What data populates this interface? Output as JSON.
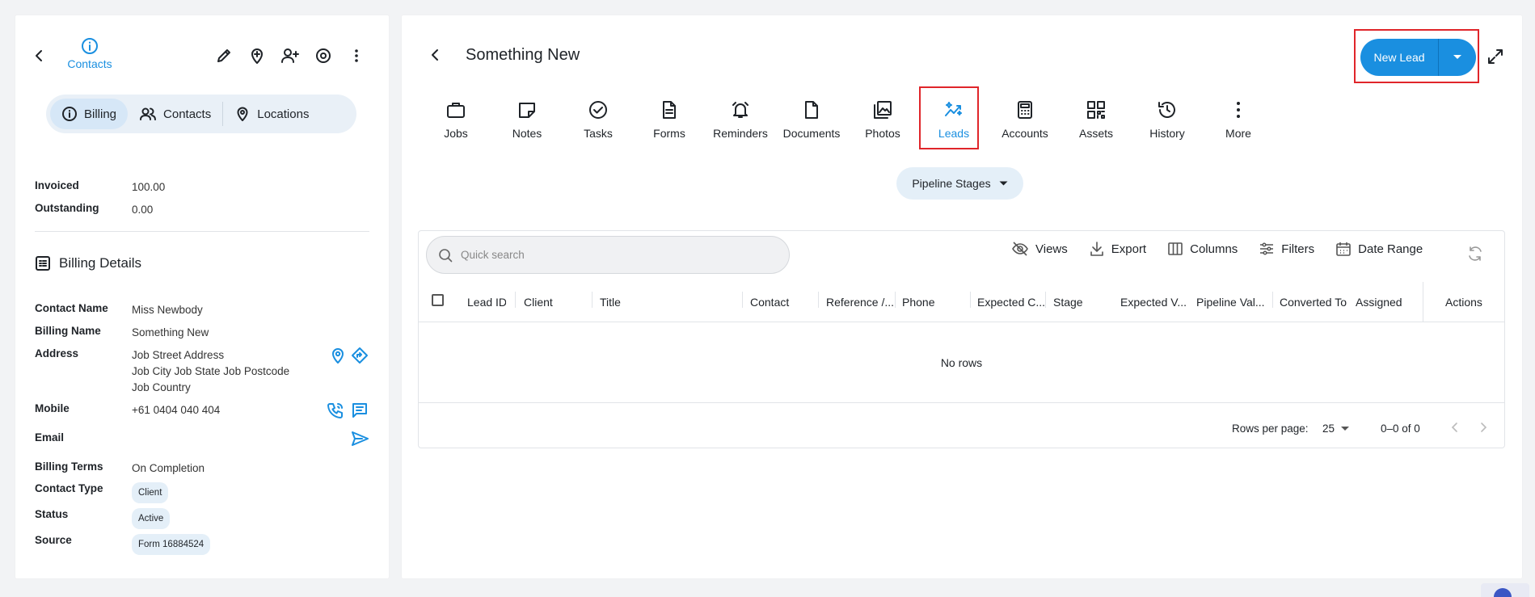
{
  "left": {
    "contacts_label": "Contacts",
    "segments": [
      {
        "label": "Billing",
        "icon": "info-icon"
      },
      {
        "label": "Contacts",
        "icon": "people-icon"
      },
      {
        "label": "Locations",
        "icon": "location-pin-icon"
      }
    ],
    "summary": {
      "invoiced_label": "Invoiced",
      "invoiced_value": "100.00",
      "outstanding_label": "Outstanding",
      "outstanding_value": "0.00"
    },
    "billing_details": {
      "title": "Billing Details",
      "contact_name_label": "Contact Name",
      "contact_name": "Miss Newbody",
      "billing_name_label": "Billing Name",
      "billing_name": "Something New",
      "address_label": "Address",
      "address_line1": "Job Street Address",
      "address_line2": "Job City Job State Job Postcode",
      "address_line3": "Job Country",
      "mobile_label": "Mobile",
      "mobile": "+61 0404 040 404",
      "email_label": "Email",
      "billing_terms_label": "Billing Terms",
      "billing_terms": "On Completion",
      "contact_type_label": "Contact Type",
      "contact_type": "Client",
      "status_label": "Status",
      "status": "Active",
      "source_label": "Source",
      "source": "Form 16884524"
    }
  },
  "right": {
    "title": "Something New",
    "new_lead_label": "New Lead",
    "tabs": [
      {
        "label": "Jobs"
      },
      {
        "label": "Notes"
      },
      {
        "label": "Tasks"
      },
      {
        "label": "Forms"
      },
      {
        "label": "Reminders"
      },
      {
        "label": "Documents"
      },
      {
        "label": "Photos"
      },
      {
        "label": "Leads"
      },
      {
        "label": "Accounts"
      },
      {
        "label": "Assets"
      },
      {
        "label": "History"
      },
      {
        "label": "More"
      }
    ],
    "active_tab": "Leads",
    "pipeline_label": "Pipeline Stages",
    "search_placeholder": "Quick search",
    "toolbar": {
      "views": "Views",
      "export": "Export",
      "columns": "Columns",
      "filters": "Filters",
      "date_range": "Date Range"
    },
    "columns": [
      "Lead ID",
      "Client",
      "Title",
      "Contact",
      "Reference /...",
      "Phone",
      "Expected C...",
      "Stage",
      "Expected V...",
      "Pipeline Val...",
      "Converted To",
      "Assigned",
      "Actions"
    ],
    "empty_text": "No rows",
    "rows_per_page_label": "Rows per page:",
    "rows_per_page": "25",
    "range_text": "0–0 of 0"
  },
  "colors": {
    "accent": "#1a8fe0",
    "highlight": "#e0252a",
    "chip_bg": "#e4eff8"
  }
}
